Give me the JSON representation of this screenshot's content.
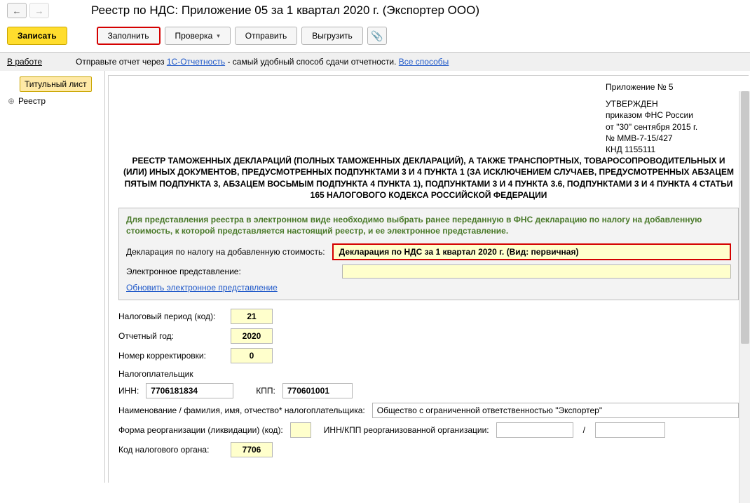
{
  "header": {
    "title": "Реестр по НДС: Приложение 05 за 1 квартал 2020 г. (Экспортер ООО)"
  },
  "toolbar": {
    "write": "Записать",
    "fill": "Заполнить",
    "check": "Проверка",
    "send": "Отправить",
    "export": "Выгрузить"
  },
  "statusbar": {
    "status": "В работе",
    "hint_pre": "Отправьте отчет через ",
    "hint_link": "1С-Отчетность",
    "hint_post": " - самый удобный способ сдачи отчетности. ",
    "all_ways": "Все способы"
  },
  "sidebar": {
    "item0": "Титульный лист",
    "item1": "Реестр"
  },
  "meta": {
    "appendix": "Приложение № 5",
    "approved": "УТВЕРЖДЕН",
    "order": "приказом ФНС России",
    "date": "от \"30\" сентября 2015 г.",
    "num": "№ ММВ-7-15/427",
    "knd": "КНД 1155111"
  },
  "long_title": "РЕЕСТР ТАМОЖЕННЫХ ДЕКЛАРАЦИЙ (ПОЛНЫХ ТАМОЖЕННЫХ ДЕКЛАРАЦИЙ), А ТАКЖЕ ТРАНСПОРТНЫХ, ТОВАРОСОПРОВОДИТЕЛЬНЫХ И (ИЛИ) ИНЫХ ДОКУМЕНТОВ, ПРЕДУСМОТРЕННЫХ ПОДПУНКТАМИ 3 И 4 ПУНКТА 1 (ЗА ИСКЛЮЧЕНИЕМ СЛУЧАЕВ, ПРЕДУСМОТРЕННЫХ АБЗАЦЕМ ПЯТЫМ ПОДПУНКТА 3, АБЗАЦЕМ ВОСЬМЫМ ПОДПУНКТА 4 ПУНКТА 1), ПОДПУНКТАМИ 3 И 4 ПУНКТА 3.6, ПОДПУНКТАМИ 3 И 4 ПУНКТА 4 СТАТЬИ 165 НАЛОГОВОГО КОДЕКСА РОССИЙСКОЙ ФЕДЕРАЦИИ",
  "panel": {
    "notice": "Для представления реестра в электронном виде необходимо выбрать ранее переданную в ФНС декларацию по налогу на добавленную стоимость, к которой представляется настоящий реестр, и ее электронное представление.",
    "decl_label": "Декларация по налогу на добавленную стоимость:",
    "decl_value": "Декларация по НДС за 1 квартал 2020 г. (Вид: первичная)",
    "eref_label": "Электронное представление:",
    "refresh_link": "Обновить электронное представление"
  },
  "fields": {
    "period_label": "Налоговый период (код):",
    "period_value": "21",
    "year_label": "Отчетный год:",
    "year_value": "2020",
    "corr_label": "Номер корректировки:",
    "corr_value": "0",
    "taxpayer_label": "Налогоплательщик",
    "inn_label": "ИНН:",
    "inn_value": "7706181834",
    "kpp_label": "КПП:",
    "kpp_value": "770601001",
    "name_label": "Наименование / фамилия, имя, отчество* налогоплательщика:",
    "name_value": "Общество с ограниченной ответственностью \"Экспортер\"",
    "reorg_label": "Форма реорганизации (ликвидации) (код):",
    "reorg_inn_label": "ИНН/КПП реорганизованной организации:",
    "taxorg_label": "Код налогового органа:",
    "taxorg_value": "7706"
  }
}
